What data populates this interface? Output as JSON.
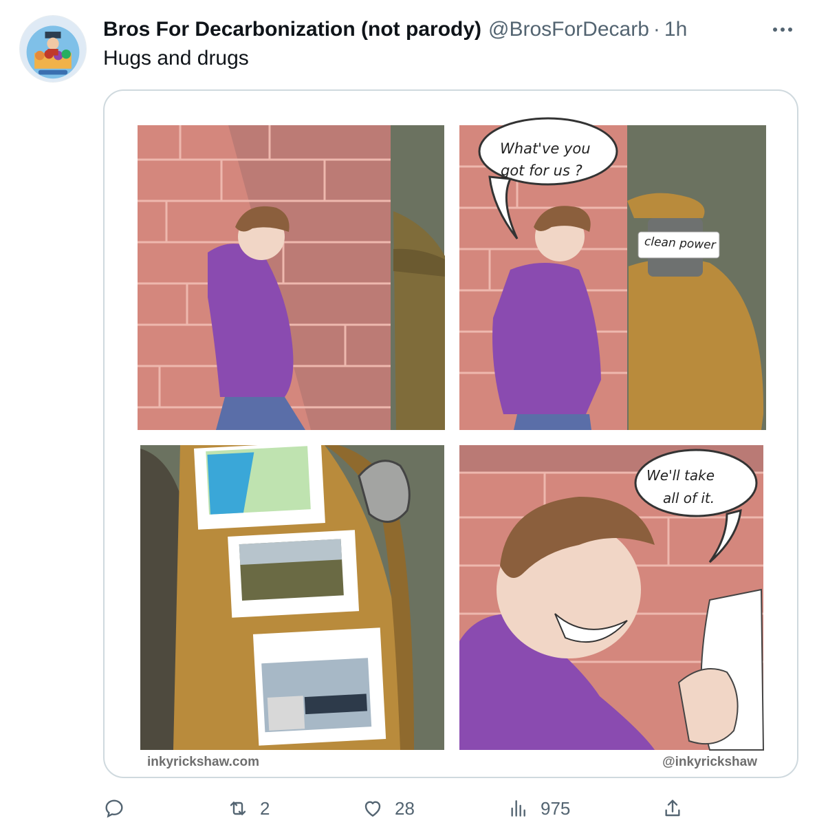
{
  "tweet": {
    "display_name": "Bros For Decarbonization (not parody)",
    "handle": "@BrosForDecarb",
    "separator": "·",
    "time": "1h",
    "text": "Hugs and drugs"
  },
  "avatar": {
    "icon": "avatar-cartoon-group"
  },
  "comic": {
    "panel2_bubble_line1": "What've you",
    "panel2_bubble_line2": "got for  us ?",
    "label_on_face": "clean power",
    "panel4_bubble_line1": "We'll  take",
    "panel4_bubble_line2": "all of it.",
    "credit_left": "inkyrickshaw.com",
    "credit_right": "@inkyrickshaw"
  },
  "actions": {
    "reply": {
      "icon": "reply-icon",
      "count": ""
    },
    "retweet": {
      "icon": "retweet-icon",
      "count": "2"
    },
    "like": {
      "icon": "heart-icon",
      "count": "28"
    },
    "views": {
      "icon": "views-icon",
      "count": "975"
    },
    "share": {
      "icon": "share-icon",
      "count": ""
    }
  },
  "colors": {
    "text_primary": "#0f1419",
    "text_secondary": "#536471",
    "border": "#cfd9de",
    "brick": "#d4877d",
    "hoodie": "#8a4bb0",
    "trenchcoat": "#b98b3c"
  }
}
